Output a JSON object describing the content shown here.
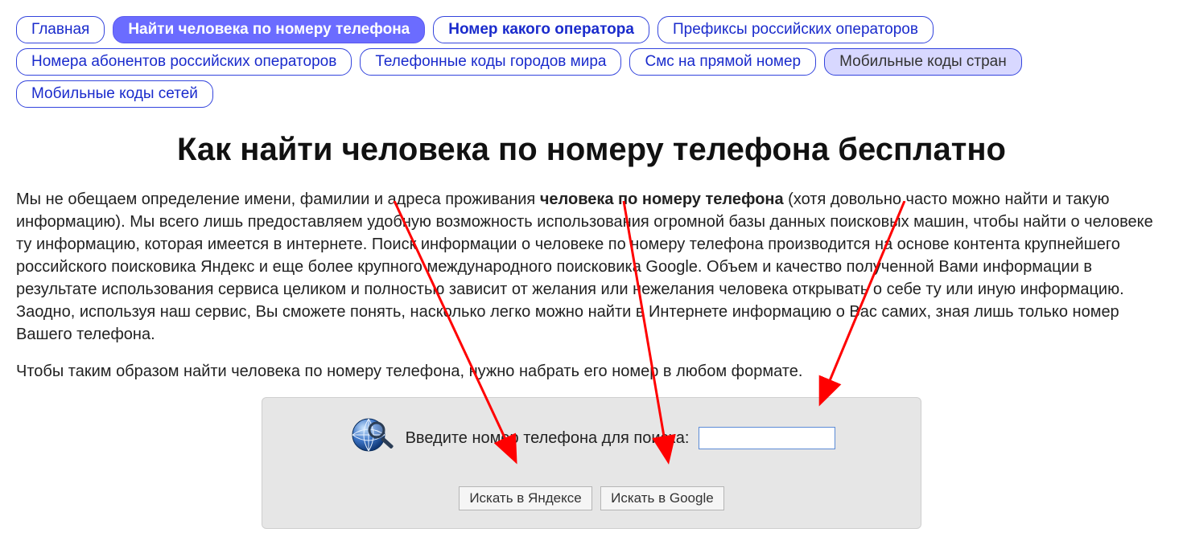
{
  "nav": {
    "items": [
      {
        "label": "Главная",
        "state": "default"
      },
      {
        "label": "Найти человека по номеру телефона",
        "state": "active"
      },
      {
        "label": "Номер какого оператора",
        "state": "bold"
      },
      {
        "label": "Префиксы российских операторов",
        "state": "default"
      },
      {
        "label": "Номера абонентов российских операторов",
        "state": "default"
      },
      {
        "label": "Телефонные коды городов мира",
        "state": "default"
      },
      {
        "label": "Смс на прямой номер",
        "state": "default"
      },
      {
        "label": "Мобильные коды стран",
        "state": "light"
      },
      {
        "label": "Мобильные коды сетей",
        "state": "default"
      }
    ]
  },
  "heading": "Как найти человека по номеру телефона бесплатно",
  "paragraph1": {
    "pre": "Мы не обещаем определение имени, фамилии и адреса проживания ",
    "bold": "человека по номеру телефона",
    "post": " (хотя довольно часто можно найти и такую информацию). Мы всего лишь предоставляем удобную возможность использования огромной базы данных поисковых машин, чтобы найти о человеке ту информацию, которая имеется в интернете. Поиск информации о человеке по номеру телефона производится на основе контента крупнейшего российского поисковика Яндекс и еще более крупного международного поисковика Google. Объем и качество полученной Вами информации в результате использования сервиса целиком и полностью зависит от желания или нежелания человека открывать о себе ту или иную информацию. Заодно, используя наш сервис, Вы сможете понять, насколько легко можно найти в Интернете информацию о Вас самих, зная лишь только номер Вашего телефона."
  },
  "paragraph2": "Чтобы таким образом найти человека по номеру телефона, нужно набрать его номер в любом формате.",
  "search": {
    "label": "Введите номер телефона для поиска:",
    "value": "",
    "button_yandex": "Искать в Яндексе",
    "button_google": "Искать в Google"
  }
}
